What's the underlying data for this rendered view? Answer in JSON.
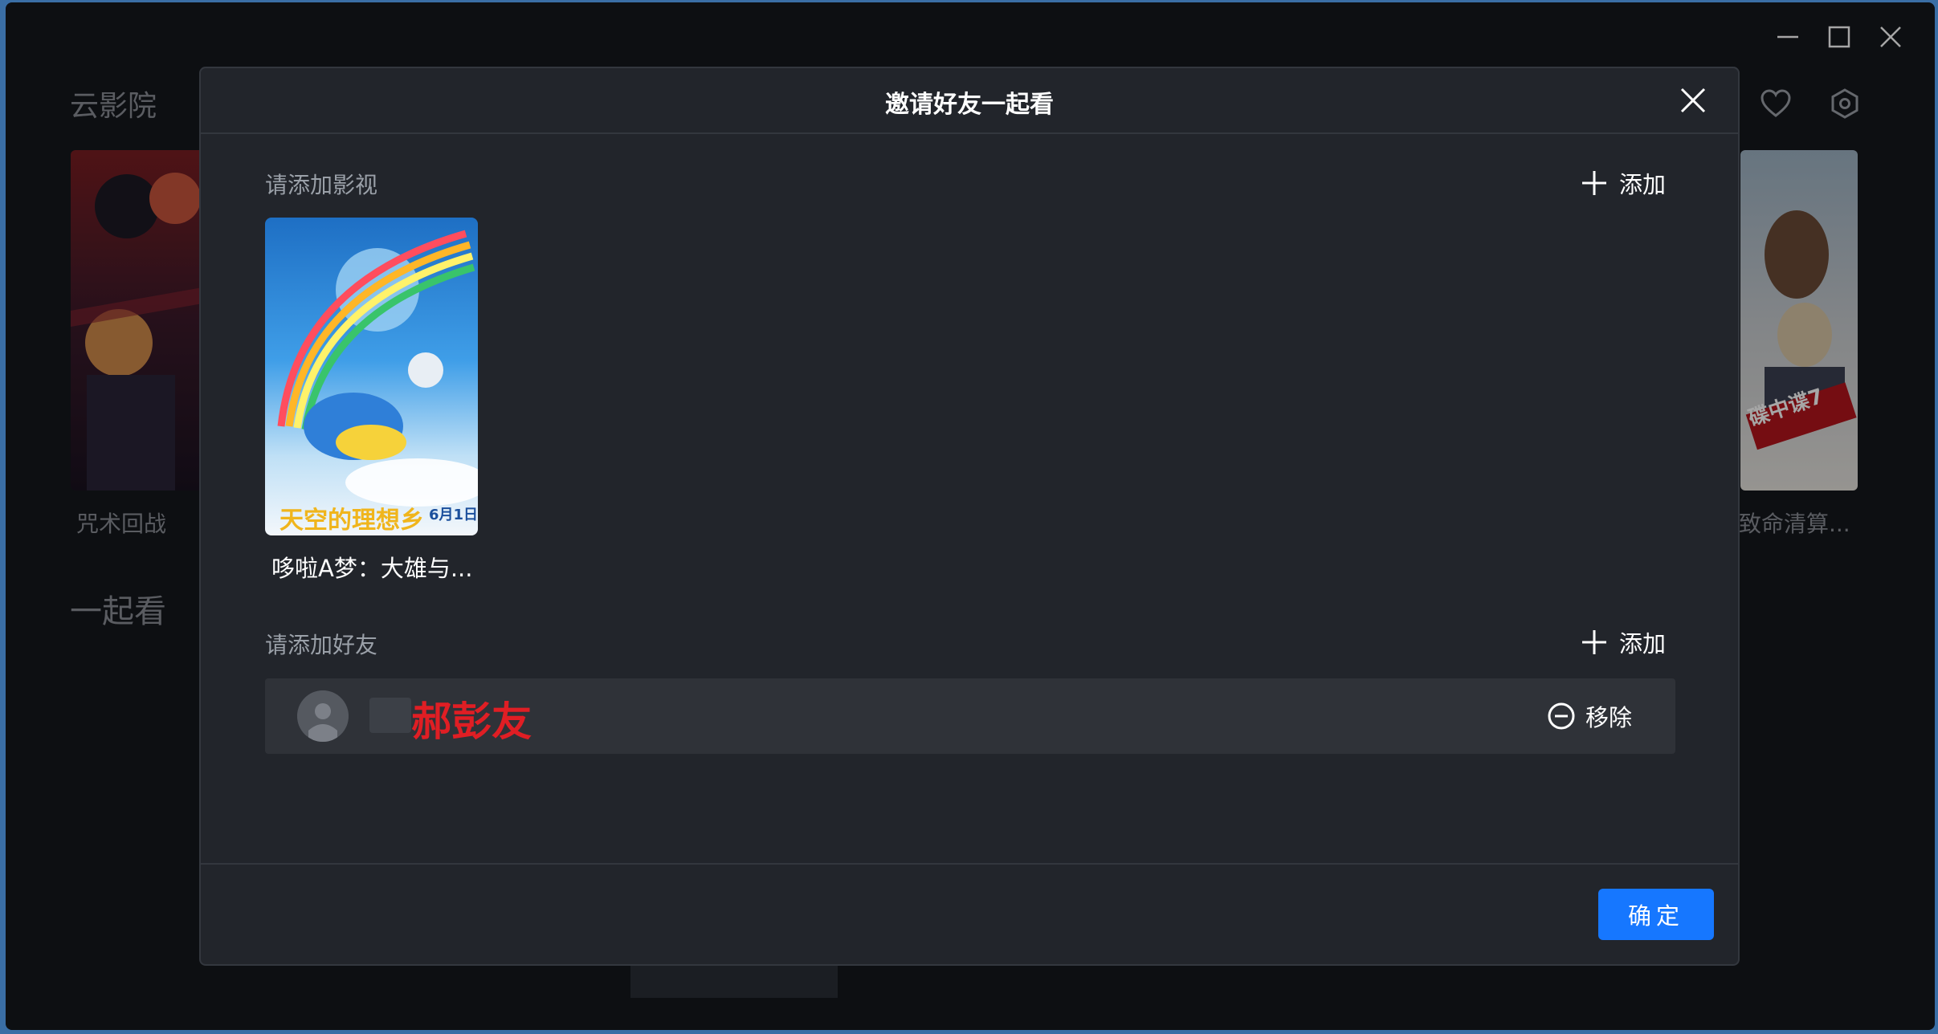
{
  "app": {
    "title": "云影院",
    "section_title": "一起看",
    "left_poster_caption": "咒术回战",
    "right_poster_caption": "致命清算...",
    "right_poster_badge": "碟中谍7"
  },
  "dialog": {
    "title": "邀请好友一起看",
    "media_section_label": "请添加影视",
    "friends_section_label": "请添加好友",
    "add_label": "添加",
    "movie": {
      "title": "哆啦A梦：大雄与...",
      "poster_text": "天空的理想乡",
      "poster_date": "6月1日"
    },
    "friend": {
      "name": "郝彭友",
      "remove_label": "移除"
    },
    "confirm_label": "确定"
  },
  "colors": {
    "accent": "#1677ff",
    "friend_name": "#e01e24",
    "dialog_bg": "#22252b",
    "window_bg": "#14171c"
  },
  "icons": [
    "minimize-icon",
    "maximize-icon",
    "close-icon",
    "heart-icon",
    "settings-icon",
    "plus-icon",
    "minus-circle-icon",
    "avatar-icon"
  ]
}
